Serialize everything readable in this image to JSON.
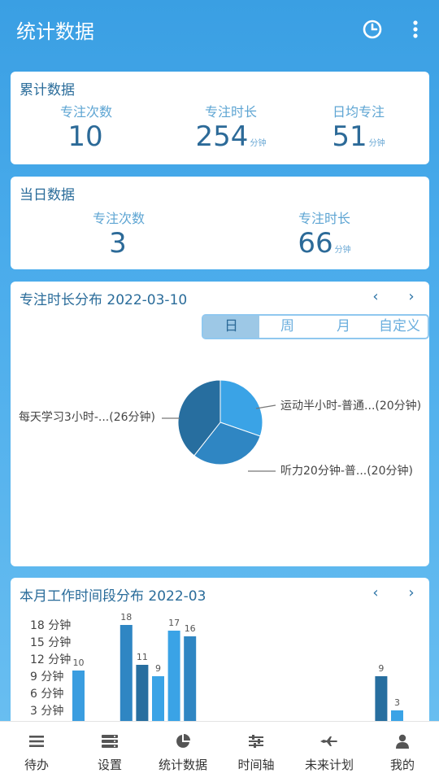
{
  "app": {
    "title": "统计数据"
  },
  "cumulative": {
    "title": "累计数据",
    "stats": [
      {
        "label": "专注次数",
        "value": "10",
        "unit": ""
      },
      {
        "label": "专注时长",
        "value": "254",
        "unit": "分钟"
      },
      {
        "label": "日均专注",
        "value": "51",
        "unit": "分钟"
      }
    ]
  },
  "daily": {
    "title": "当日数据",
    "stats": [
      {
        "label": "专注次数",
        "value": "3",
        "unit": ""
      },
      {
        "label": "专注时长",
        "value": "66",
        "unit": "分钟"
      }
    ]
  },
  "pie_card": {
    "title": "专注时长分布 2022-03-10",
    "prev": "‹",
    "next": "›",
    "segments": [
      "日",
      "周",
      "月",
      "自定义"
    ],
    "active_segment": "日"
  },
  "bar_card": {
    "title": "本月工作时间段分布 2022-03",
    "prev": "‹",
    "next": "›"
  },
  "chart_data": [
    {
      "type": "pie",
      "slices": [
        {
          "label": "运动半小时-普通...(20分钟)",
          "value": 20,
          "color": "#3aa3e6"
        },
        {
          "label": "听力20分钟-普...(20分钟)",
          "value": 20,
          "color": "#2f86c3"
        },
        {
          "label": "每天学习3小时-...(26分钟)",
          "value": 26,
          "color": "#276e9f"
        }
      ]
    },
    {
      "type": "bar",
      "ylabels": [
        "18 分钟",
        "15 分钟",
        "12 分钟",
        "9 分钟",
        "6 分钟",
        "3 分钟"
      ],
      "yticks": [
        18,
        15,
        12,
        9,
        6,
        3
      ],
      "ylim": [
        0,
        21
      ],
      "slots": 24,
      "bars": [
        {
          "slot": 0,
          "value": 10,
          "color": "#3a9de0"
        },
        {
          "slot": 3,
          "value": 18,
          "color": "#2f86c3"
        },
        {
          "slot": 4,
          "value": 11,
          "color": "#276e9f"
        },
        {
          "slot": 5,
          "value": 9,
          "color": "#3aa3e6"
        },
        {
          "slot": 6,
          "value": 17,
          "color": "#3aa3e6"
        },
        {
          "slot": 7,
          "value": 16,
          "color": "#2f86c3"
        },
        {
          "slot": 19,
          "value": 9,
          "color": "#276e9f"
        },
        {
          "slot": 20,
          "value": 3,
          "color": "#3aa3e6"
        }
      ]
    }
  ],
  "bottom_nav": [
    {
      "label": "待办",
      "icon": "menu-icon"
    },
    {
      "label": "设置",
      "icon": "settings-icon"
    },
    {
      "label": "统计数据",
      "icon": "pie-chart-icon"
    },
    {
      "label": "时间轴",
      "icon": "timeline-icon"
    },
    {
      "label": "未来计划",
      "icon": "plane-icon"
    },
    {
      "label": "我的",
      "icon": "user-icon"
    }
  ]
}
